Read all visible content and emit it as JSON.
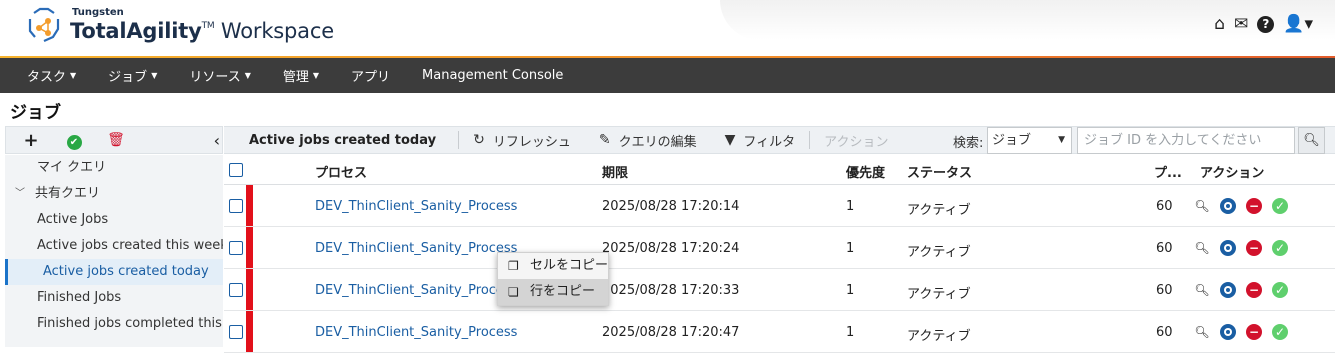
{
  "header": {
    "brand_small": "Tungsten",
    "brand_bold": "TotalAgility",
    "brand_tm": "TM",
    "brand_rest": " Workspace",
    "icons": [
      "home-icon",
      "inbox-icon",
      "help-icon",
      "user-icon"
    ]
  },
  "nav": {
    "items": [
      {
        "label": "タスク",
        "dropdown": true
      },
      {
        "label": "ジョブ",
        "dropdown": true
      },
      {
        "label": "リソース",
        "dropdown": true
      },
      {
        "label": "管理",
        "dropdown": true
      },
      {
        "label": "アプリ",
        "dropdown": false
      },
      {
        "label": "Management Console",
        "dropdown": false
      }
    ]
  },
  "page": {
    "title": "ジョブ"
  },
  "left_toolbar": {
    "icons": [
      "add-icon",
      "check-icon",
      "delete-icon",
      "collapse-icon"
    ],
    "glyphs": [
      "+",
      "✔",
      "🗑",
      "‹"
    ]
  },
  "left_list": {
    "my_queries": "マイ クエリ",
    "shared_queries": "共有クエリ",
    "items": [
      "Active Jobs",
      "Active jobs created this week",
      "Active jobs created today",
      "Finished Jobs",
      "Finished jobs completed this week"
    ]
  },
  "toolbar": {
    "title": "Active jobs created today",
    "refresh": "リフレッシュ",
    "edit_query": "クエリの編集",
    "filter": "フィルタ",
    "action": "アクション",
    "search_label": "検索:",
    "search_select": "ジョブ",
    "search_placeholder": "ジョブ ID を入力してください"
  },
  "table": {
    "columns": {
      "process": "プロセス",
      "deadline": "期限",
      "priority": "優先度",
      "status": "ステータス",
      "progress": "プ...",
      "actions": "アクション"
    },
    "rows": [
      {
        "process": "DEV_ThinClient_Sanity_Process",
        "deadline": "2025/08/28 17:20:14",
        "priority": "1",
        "status": "アクティブ",
        "progress": "60"
      },
      {
        "process": "DEV_ThinClient_Sanity_Process",
        "deadline": "2025/08/28 17:20:24",
        "priority": "1",
        "status": "アクティブ",
        "progress": "60"
      },
      {
        "process": "DEV_ThinClient_Sanity_Process",
        "deadline": "2025/08/28 17:20:33",
        "priority": "1",
        "status": "アクティブ",
        "progress": "60"
      },
      {
        "process": "DEV_ThinClient_Sanity_Process",
        "deadline": "2025/08/28 17:20:47",
        "priority": "1",
        "status": "アクティブ",
        "progress": "60"
      }
    ]
  },
  "context_menu": {
    "copy_cell": "セルをコピー",
    "copy_row": "行をコピー"
  },
  "colors": {
    "accent_start": "#f6b32d",
    "accent_end": "#e35c2b",
    "nav_bg": "#3c3c3c",
    "link": "#1a5ea3",
    "row_flag": "#e2101a"
  }
}
